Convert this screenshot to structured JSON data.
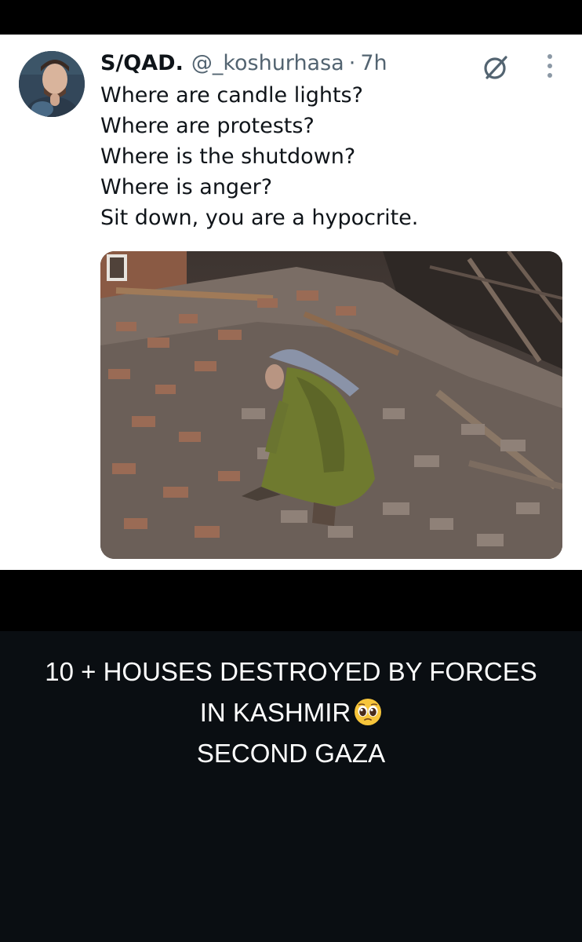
{
  "tweet": {
    "author_name": "S/QAD.",
    "author_handle": "@_koshurhasa",
    "separator": "·",
    "time": "7h",
    "lines": [
      "Where are candle lights?",
      "Where are protests?",
      "Where is the shutdown?",
      "Where is anger?",
      "Sit down, you are a hypocrite."
    ],
    "icons": {
      "grok": "grok-icon",
      "more": "more-options-icon",
      "avatar": "avatar"
    }
  },
  "caption": {
    "line1": "10 + HOUSES DESTROYED BY FORCES",
    "line2": "IN KASHMIR",
    "line2_emoji": "pleading-face-emoji",
    "line3": "SECOND GAZA"
  },
  "colors": {
    "text": "#0f1419",
    "muted": "#536471",
    "card_bg": "#ffffff",
    "caption_bg": "#0a0e12",
    "caption_text": "#ffffff"
  }
}
